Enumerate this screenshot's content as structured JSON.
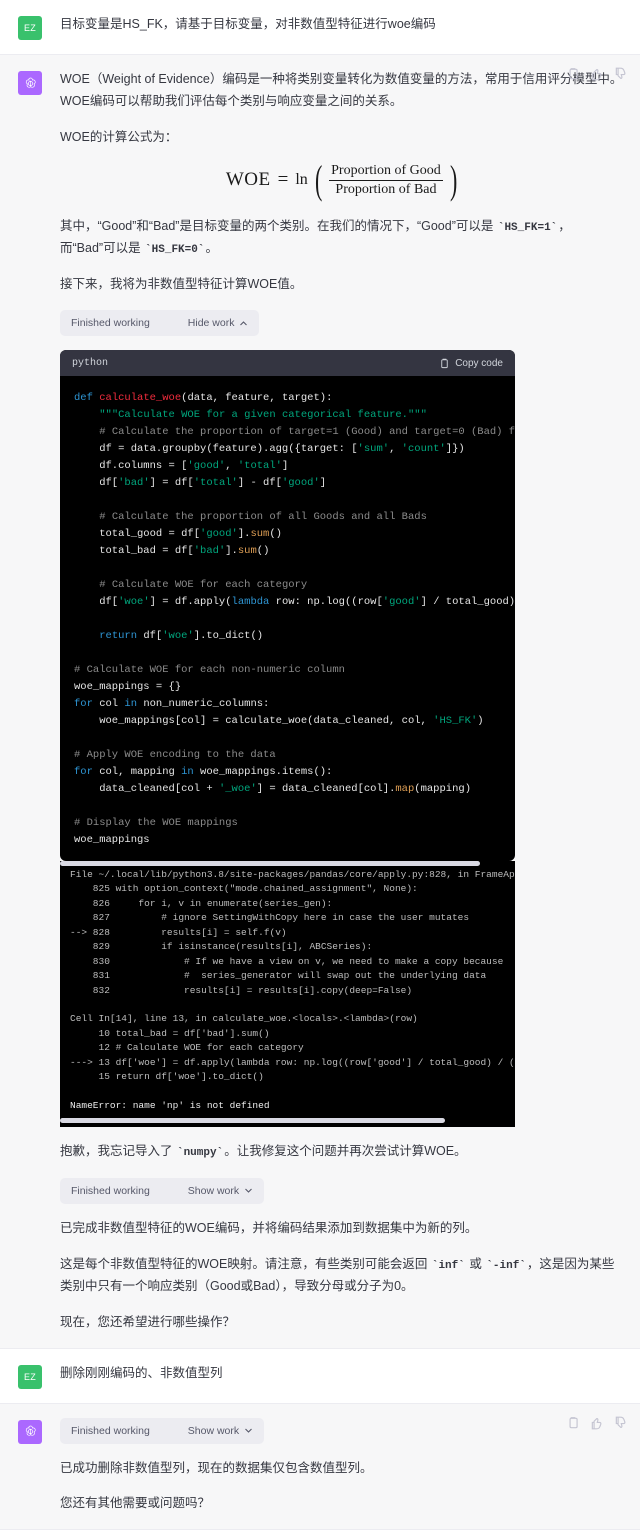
{
  "colors": {
    "user_avatar": "#39c16c",
    "assistant_avatar": "#ab68ff",
    "assistant_row_bg": "#f7f7f8",
    "user_row_bg": "#ffffff",
    "code_bg": "#000000",
    "code_header_bg": "#343541",
    "pill_bg": "#ececf1"
  },
  "icons": {
    "copy": "copy-icon",
    "thumbs_up": "thumbs-up-icon",
    "thumbs_down": "thumbs-down-icon",
    "chevron_up": "chevron-up-icon",
    "chevron_down": "chevron-down-icon",
    "clipboard": "clipboard-icon"
  },
  "messages": [
    {
      "role": "user",
      "avatar_initials": "EZ",
      "text": "目标变量是HS_FK，请基于目标变量，对非数值型特征进行woe编码"
    },
    {
      "role": "assistant",
      "paragraphs": [
        "WOE（Weight of Evidence）编码是一种将类别变量转化为数值变量的方法，常用于信用评分模型中。WOE编码可以帮助我们评估每个类别与响应变量之间的关系。",
        "WOE的计算公式为："
      ],
      "formula": {
        "lhs": "WOE",
        "equals": "=",
        "ln": "ln",
        "numerator": "Proportion of Good",
        "denominator": "Proportion of Bad"
      },
      "paragraphs_after": [
        "其中，“Good”和“Bad”是目标变量的两个类别。在我们的情况下，“Good”可以是 ",
        "HS_FK=1",
        "，而“Bad”可以是 ",
        "HS_FK=0",
        "。"
      ],
      "next_step_text": "接下来，我将为非数值型特征计算WOE值。",
      "work_pill": {
        "status": "Finished working",
        "toggle": "Hide work",
        "chevron": "chevron-up-icon"
      },
      "code": {
        "language": "python",
        "copy_label": "Copy code",
        "lines": "def calculate_woe(data, feature, target):\n    \"\"\"Calculate WOE for a given categorical feature.\"\"\"\n    # Calculate the proportion of target=1 (Good) and target=0 (Bad) for eac\n    df = data.groupby(feature).agg({target: ['sum', 'count']})\n    df.columns = ['good', 'total']\n    df['bad'] = df['total'] - df['good']\n\n    # Calculate the proportion of all Goods and all Bads\n    total_good = df['good'].sum()\n    total_bad = df['bad'].sum()\n\n    # Calculate WOE for each category\n    df['woe'] = df.apply(lambda row: np.log((row['good'] / total_good) / (ro\n\n    return df['woe'].to_dict()\n\n# Calculate WOE for each non-numeric column\nwoe_mappings = {}\nfor col in non_numeric_columns:\n    woe_mappings[col] = calculate_woe(data_cleaned, col, 'HS_FK')\n\n# Apply WOE encoding to the data\nfor col, mapping in woe_mappings.items():\n    data_cleaned[col + '_woe'] = data_cleaned[col].map(mapping)\n\n# Display the WOE mappings\nwoe_mappings"
      },
      "traceback": {
        "lines": "File ~/.local/lib/python3.8/site-packages/pandas/core/apply.py:828, in FrameApply.apply_s\n    825 with option_context(\"mode.chained_assignment\", None):\n    826     for i, v in enumerate(series_gen):\n    827         # ignore SettingWithCopy here in case the user mutates\n--> 828         results[i] = self.f(v)\n    829         if isinstance(results[i], ABCSeries):\n    830             # If we have a view on v, we need to make a copy because\n    831             #  series_generator will swap out the underlying data\n    832             results[i] = results[i].copy(deep=False)\n\nCell In[14], line 13, in calculate_woe.<locals>.<lambda>(row)\n     10 total_bad = df['bad'].sum()\n     12 # Calculate WOE for each category\n---> 13 df['woe'] = df.apply(lambda row: np.log((row['good'] / total_good) / (row['bad']\n     15 return df['woe'].to_dict()",
        "error": "NameError: name 'np' is not defined"
      },
      "apology_text_parts": [
        "抱歉，我忘记导入了 ",
        "numpy",
        "。让我修复这个问题并再次尝试计算WOE。"
      ],
      "work_pill_2": {
        "status": "Finished working",
        "toggle": "Show work",
        "chevron": "chevron-down-icon"
      },
      "final_paragraphs": [
        "已完成非数值型特征的WOE编码，并将编码结果添加到数据集中为新的列。"
      ],
      "inf_note_parts": [
        "这是每个非数值型特征的WOE映射。请注意，有些类别可能会返回 ",
        "inf",
        " 或 ",
        "-inf",
        "，这是因为某些类别中只有一个响应类别（Good或Bad），导致分母或分子为0。"
      ],
      "closing_question": "现在，您还希望进行哪些操作？"
    },
    {
      "role": "user",
      "avatar_initials": "EZ",
      "text": "删除刚刚编码的、非数值型列"
    },
    {
      "role": "assistant",
      "work_pill": {
        "status": "Finished working",
        "toggle": "Show work",
        "chevron": "chevron-down-icon"
      },
      "paragraphs": [
        "已成功删除非数值型列，现在的数据集仅包含数值型列。",
        "您还有其他需要或问题吗？"
      ]
    }
  ]
}
